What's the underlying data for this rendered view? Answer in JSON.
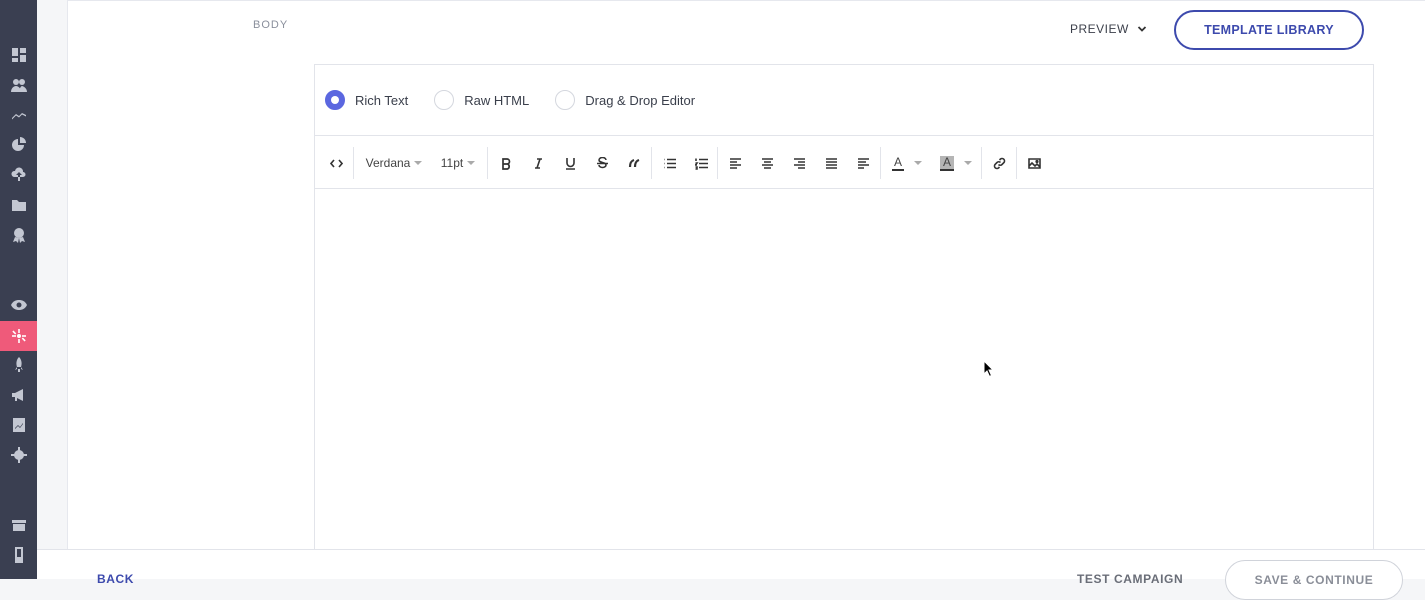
{
  "section": {
    "label": "BODY"
  },
  "header": {
    "preview_label": "PREVIEW",
    "template_library_label": "TEMPLATE LIBRARY"
  },
  "editor_modes": [
    {
      "label": "Rich Text",
      "selected": true
    },
    {
      "label": "Raw HTML",
      "selected": false
    },
    {
      "label": "Drag & Drop Editor",
      "selected": false
    }
  ],
  "toolbar": {
    "font_family": "Verdana",
    "font_size": "11pt",
    "text_color_letter": "A",
    "highlight_letter": "A"
  },
  "footer": {
    "back_label": "BACK",
    "test_label": "TEST CAMPAIGN",
    "save_label": "SAVE & CONTINUE"
  },
  "colors": {
    "accent": "#3d4aad",
    "radio": "#5b67e0",
    "sidebar": "#3a3f51",
    "active_nav": "#ef5a7a"
  }
}
